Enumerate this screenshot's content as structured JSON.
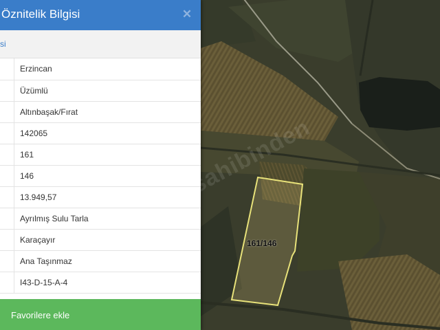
{
  "panel": {
    "title": "Öznitelik Bilgisi",
    "close_icon": "close-icon",
    "section_label": "si",
    "rows": [
      {
        "value": "Erzincan"
      },
      {
        "value": "Üzümlü"
      },
      {
        "value": "Altınbaşak/Fırat"
      },
      {
        "value": "142065"
      },
      {
        "value": "161"
      },
      {
        "value": "146"
      },
      {
        "value": "13.949,57"
      },
      {
        "value": "Ayrılmış Sulu Tarla"
      },
      {
        "value": "Karaçayır"
      },
      {
        "value": "Ana Taşınmaz"
      },
      {
        "value": "I43-D-15-A-4"
      }
    ],
    "favorite_button": "Favorilere ekle"
  },
  "map": {
    "parcel_label": "161/146",
    "watermark": "sahibinden",
    "parcel_outline_color": "#e8e27a"
  },
  "colors": {
    "header": "#3a7dc9",
    "favorite_button": "#5cb85c"
  }
}
